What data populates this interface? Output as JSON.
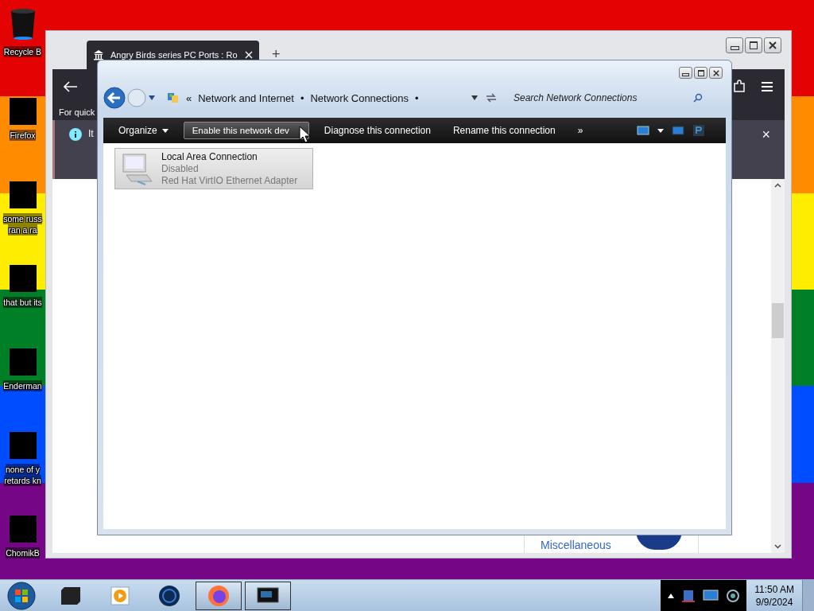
{
  "desktop": {
    "icons": [
      {
        "lines": [
          "Recycle B"
        ]
      },
      {
        "lines": [
          "Firefox"
        ]
      },
      {
        "lines": [
          "some russ",
          "ran a ra"
        ]
      },
      {
        "lines": [
          "that but its"
        ]
      },
      {
        "lines": [
          "Enderman"
        ]
      },
      {
        "lines": [
          "none of y",
          "retards kn"
        ]
      },
      {
        "lines": [
          "ChomikB"
        ]
      }
    ]
  },
  "browser": {
    "tab": {
      "title": "Angry Birds series PC Ports : Ro",
      "selected": true
    },
    "new_tab": "+",
    "bookmarks_text": "For quick",
    "notification": {
      "text": "It",
      "close": "×"
    },
    "link": "Miscellaneous"
  },
  "explorer": {
    "breadcrumb": {
      "overflow": "«",
      "items": [
        "Network and Internet",
        "Network Connections"
      ],
      "separator": "•"
    },
    "search": {
      "placeholder": "Search Network Connections"
    },
    "commands": [
      {
        "label": "Organize",
        "dropdown": true,
        "selected": false
      },
      {
        "label": "Enable this network dev",
        "dropdown": false,
        "selected": true
      },
      {
        "label": "Diagnose this connection",
        "dropdown": false,
        "selected": false
      },
      {
        "label": "Rename this connection",
        "dropdown": false,
        "selected": false
      },
      {
        "label": "»",
        "dropdown": false,
        "selected": false
      }
    ],
    "connections": [
      {
        "name": "Local Area Connection",
        "status": "Disabled",
        "adapter": "Red Hat VirtIO Ethernet Adapter",
        "selected": true
      }
    ]
  },
  "taskbar": {
    "apps": [
      {
        "kind": "device",
        "running": false
      },
      {
        "kind": "player",
        "running": false
      },
      {
        "kind": "globe",
        "running": false
      },
      {
        "kind": "firefox",
        "running": true
      },
      {
        "kind": "window",
        "running": true
      }
    ],
    "clock": {
      "time": "11:50 AM",
      "date": "9/9/2024"
    }
  }
}
